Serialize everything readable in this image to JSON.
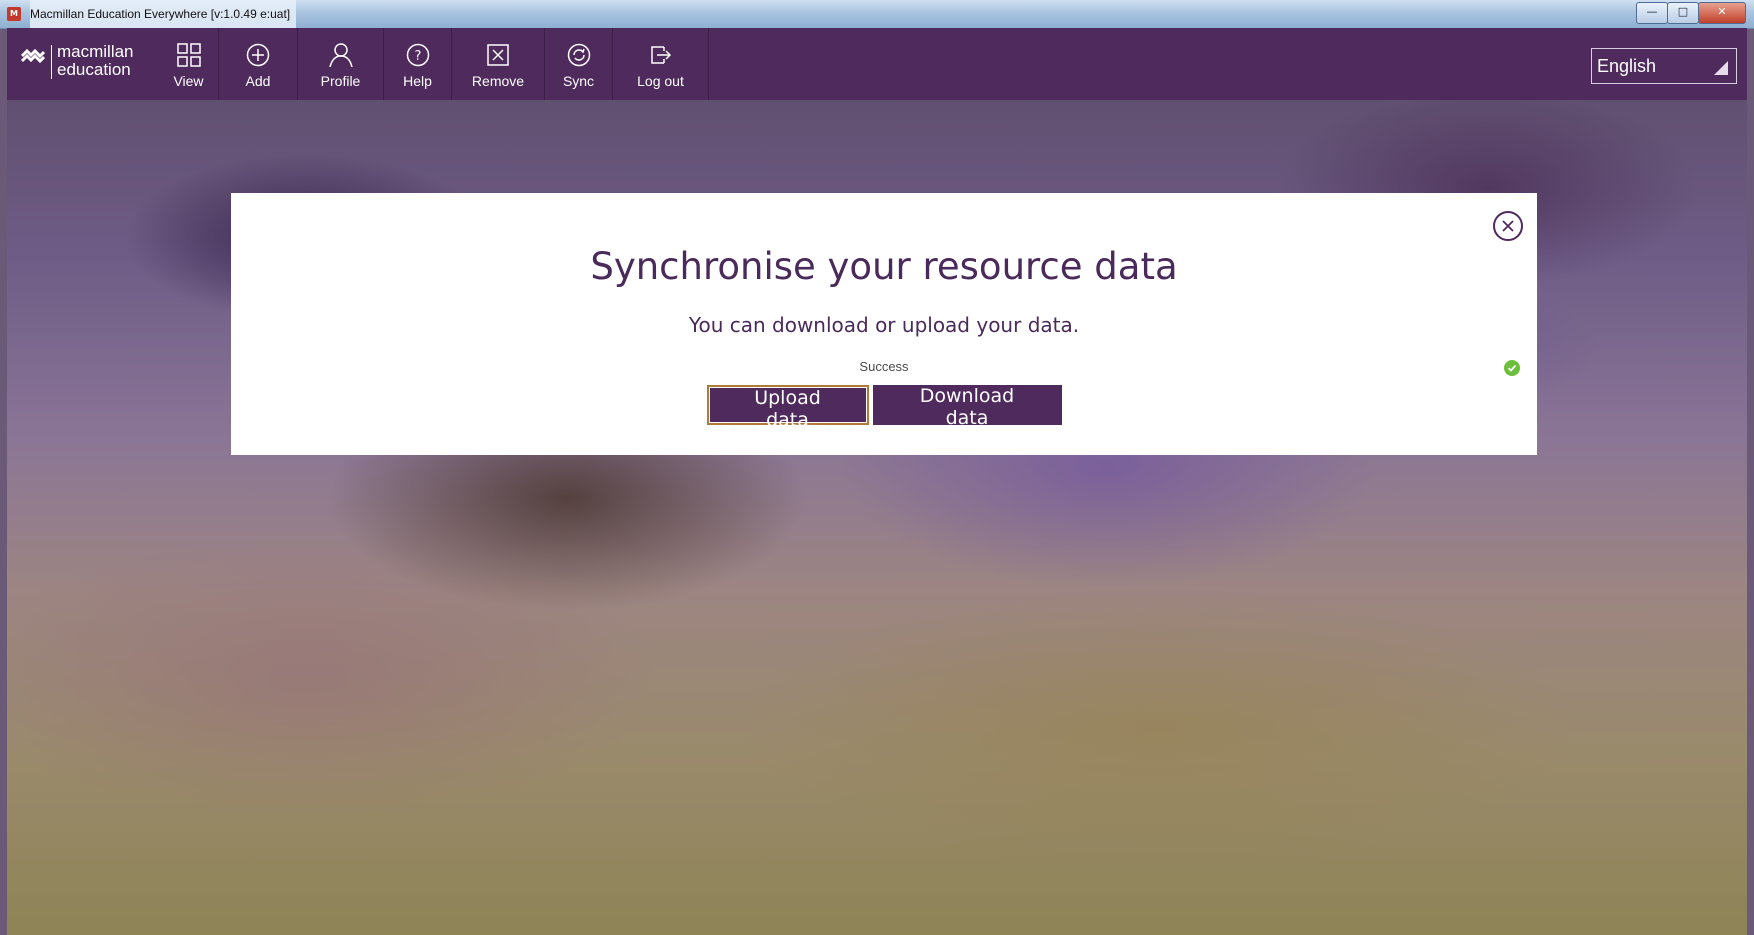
{
  "window": {
    "title": "Macmillan Education Everywhere [v:1.0.49 e:uat]",
    "app_icon_text": "M",
    "controls": [
      "minimize",
      "maximize",
      "close"
    ]
  },
  "logo": {
    "line1": "macmillan",
    "line2": "education"
  },
  "nav": [
    {
      "label": "View",
      "icon": "grid-icon"
    },
    {
      "label": "Add",
      "icon": "plus-circle-icon"
    },
    {
      "label": "Profile",
      "icon": "person-icon"
    },
    {
      "label": "Help",
      "icon": "question-circle-icon"
    },
    {
      "label": "Remove",
      "icon": "x-box-icon"
    },
    {
      "label": "Sync",
      "icon": "sync-icon"
    },
    {
      "label": "Log out",
      "icon": "logout-icon"
    }
  ],
  "language": {
    "selected": "English"
  },
  "modal": {
    "title": "Synchronise your resource data",
    "subtitle": "You can download or upload your data.",
    "status": "Success",
    "upload_label": "Upload data",
    "download_label": "Download data"
  },
  "colors": {
    "brand_purple": "#4f2a5c",
    "success_green": "#6bbf3a",
    "upload_border": "#b07a3a"
  }
}
